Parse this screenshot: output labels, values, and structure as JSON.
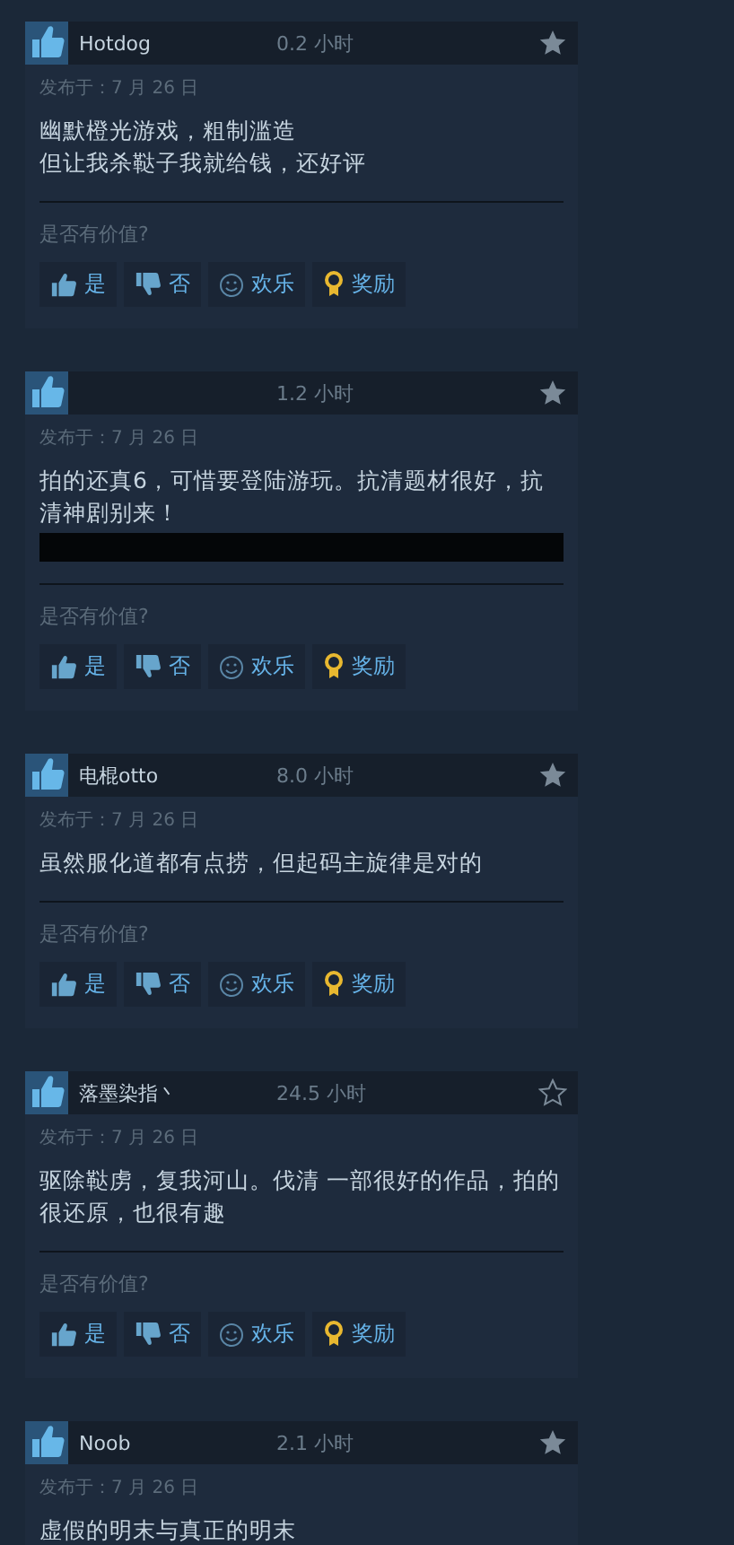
{
  "reviews": [
    {
      "username": "Hotdog",
      "hours": "0.2 小时",
      "starred": true,
      "date": "发布于：7 月 26 日",
      "lines": [
        "幽默橙光游戏，粗制滥造",
        "但让我杀鞑子我就给钱，还好评"
      ],
      "redacted": false,
      "question": "是否有价值?",
      "actions": [
        {
          "kind": "up",
          "label": "是"
        },
        {
          "kind": "down",
          "label": "否"
        },
        {
          "kind": "funny",
          "label": "欢乐"
        },
        {
          "kind": "award",
          "label": "奖励"
        }
      ]
    },
    {
      "hours": "1.2 小时",
      "starred": true,
      "date": "发布于：7 月 26 日",
      "lines": [
        "拍的还真6，可惜要登陆游玩。抗清题材很好，抗清神剧别来！"
      ],
      "redacted": true,
      "question": "是否有价值?",
      "actions": [
        {
          "kind": "up",
          "label": "是"
        },
        {
          "kind": "down",
          "label": "否"
        },
        {
          "kind": "funny",
          "label": "欢乐"
        },
        {
          "kind": "award",
          "label": "奖励"
        }
      ]
    },
    {
      "username": "电棍otto",
      "hours": "8.0 小时",
      "starred": true,
      "date": "发布于：7 月 26 日",
      "lines": [
        "虽然服化道都有点捞，但起码主旋律是对的"
      ],
      "redacted": false,
      "question": "是否有价值?",
      "actions": [
        {
          "kind": "up",
          "label": "是"
        },
        {
          "kind": "down",
          "label": "否"
        },
        {
          "kind": "funny",
          "label": "欢乐"
        },
        {
          "kind": "award",
          "label": "奖励"
        }
      ]
    },
    {
      "username": "落墨染指丶",
      "hours": "24.5 小时",
      "starred": false,
      "date": "发布于：7 月 26 日",
      "lines": [
        "驱除鞑虏，复我河山。伐清 一部很好的作品，拍的很还原，也很有趣"
      ],
      "redacted": false,
      "question": "是否有价值?",
      "actions": [
        {
          "kind": "up",
          "label": "是"
        },
        {
          "kind": "down",
          "label": "否"
        },
        {
          "kind": "funny",
          "label": "欢乐"
        },
        {
          "kind": "award",
          "label": "奖励"
        }
      ]
    },
    {
      "username": "Noob",
      "hours": "2.1 小时",
      "starred": true,
      "date": "发布于：7 月 26 日",
      "lines": [
        "虚假的明末与真正的明末"
      ],
      "redacted": false
    }
  ]
}
